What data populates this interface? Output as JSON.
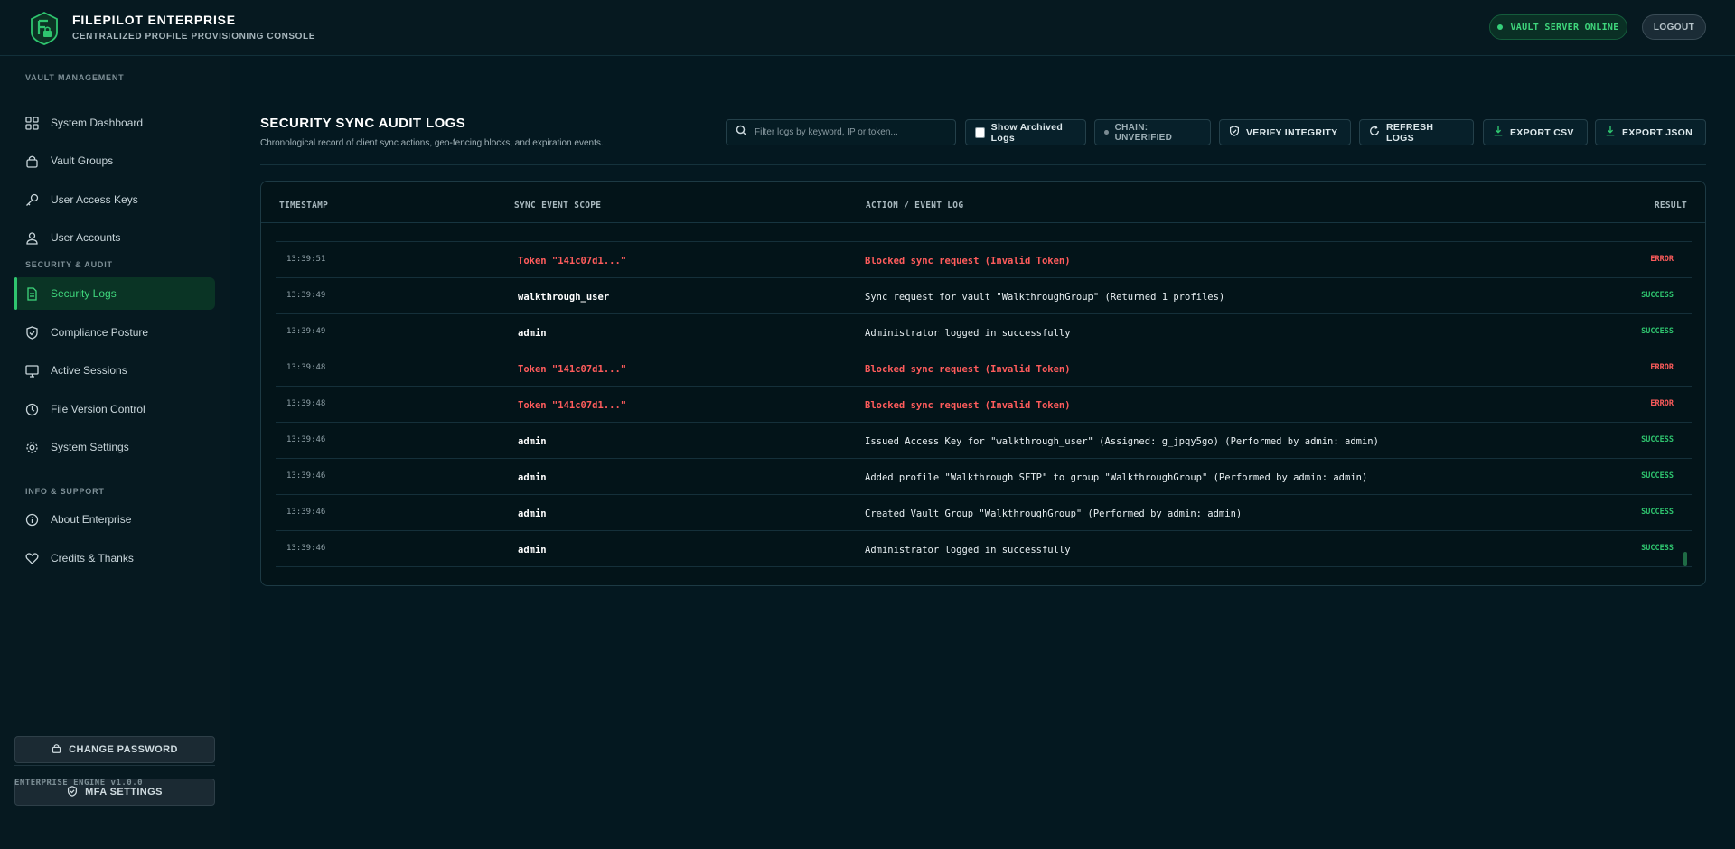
{
  "header": {
    "title": "FILEPILOT ENTERPRISE",
    "subtitle": "CENTRALIZED PROFILE PROVISIONING CONSOLE",
    "status": "VAULT SERVER ONLINE",
    "logout": "LOGOUT"
  },
  "sidebar": {
    "sections": [
      {
        "label": "VAULT MANAGEMENT"
      },
      {
        "label": "SECURITY & AUDIT"
      },
      {
        "label": "INFO & SUPPORT"
      }
    ],
    "items": [
      {
        "label": "System Dashboard",
        "icon": "grid-icon"
      },
      {
        "label": "Vault Groups",
        "icon": "lock-icon"
      },
      {
        "label": "User Access Keys",
        "icon": "key-icon"
      },
      {
        "label": "User Accounts",
        "icon": "users-icon"
      },
      {
        "label": "Security Logs",
        "icon": "document-icon",
        "active": true
      },
      {
        "label": "Compliance Posture",
        "icon": "shield-check-icon"
      },
      {
        "label": "Active Sessions",
        "icon": "monitor-icon"
      },
      {
        "label": "File Version Control",
        "icon": "clock-icon"
      },
      {
        "label": "System Settings",
        "icon": "gear-icon"
      },
      {
        "label": "About Enterprise",
        "icon": "info-icon"
      },
      {
        "label": "Credits & Thanks",
        "icon": "heart-icon"
      }
    ],
    "change_password": "CHANGE PASSWORD",
    "mfa_settings": "MFA SETTINGS",
    "engine": "ENTERPRISE ENGINE v1.0.0"
  },
  "main": {
    "title": "SECURITY SYNC AUDIT LOGS",
    "subtitle": "Chronological record of client sync actions, geo-fencing blocks, and expiration events.",
    "search_placeholder": "Filter logs by keyword, IP or token...",
    "show_archived": "Show Archived Logs",
    "chain_status": "CHAIN: UNVERIFIED",
    "verify": "VERIFY INTEGRITY",
    "refresh": "REFRESH LOGS",
    "export_csv": "EXPORT CSV",
    "export_json": "EXPORT JSON"
  },
  "table": {
    "columns": [
      "TIMESTAMP",
      "SYNC EVENT SCOPE",
      "ACTION / EVENT LOG",
      "RESULT"
    ],
    "rows": [
      {
        "time": "13:39:51",
        "scope": "Token \"141c07d1...\"",
        "action": "Blocked sync request (Invalid Token)",
        "result": "ERROR"
      },
      {
        "time": "13:39:49",
        "scope": "walkthrough_user",
        "action": "Sync request for vault \"WalkthroughGroup\" (Returned 1 profiles)",
        "result": "SUCCESS"
      },
      {
        "time": "13:39:49",
        "scope": "admin",
        "action": "Administrator logged in successfully",
        "result": "SUCCESS"
      },
      {
        "time": "13:39:48",
        "scope": "Token \"141c07d1...\"",
        "action": "Blocked sync request (Invalid Token)",
        "result": "ERROR"
      },
      {
        "time": "13:39:48",
        "scope": "Token \"141c07d1...\"",
        "action": "Blocked sync request (Invalid Token)",
        "result": "ERROR"
      },
      {
        "time": "13:39:46",
        "scope": "admin",
        "action": "Issued Access Key for \"walkthrough_user\" (Assigned: g_jpqy5go) (Performed by admin: admin)",
        "result": "SUCCESS"
      },
      {
        "time": "13:39:46",
        "scope": "admin",
        "action": "Added profile \"Walkthrough SFTP\" to group \"WalkthroughGroup\" (Performed by admin: admin)",
        "result": "SUCCESS"
      },
      {
        "time": "13:39:46",
        "scope": "admin",
        "action": "Created Vault Group \"WalkthroughGroup\" (Performed by admin: admin)",
        "result": "SUCCESS"
      },
      {
        "time": "13:39:46",
        "scope": "admin",
        "action": "Administrator logged in successfully",
        "result": "SUCCESS"
      }
    ]
  },
  "colors": {
    "accent": "#2fc56f",
    "error": "#ff5c5c",
    "background": "#041820"
  }
}
